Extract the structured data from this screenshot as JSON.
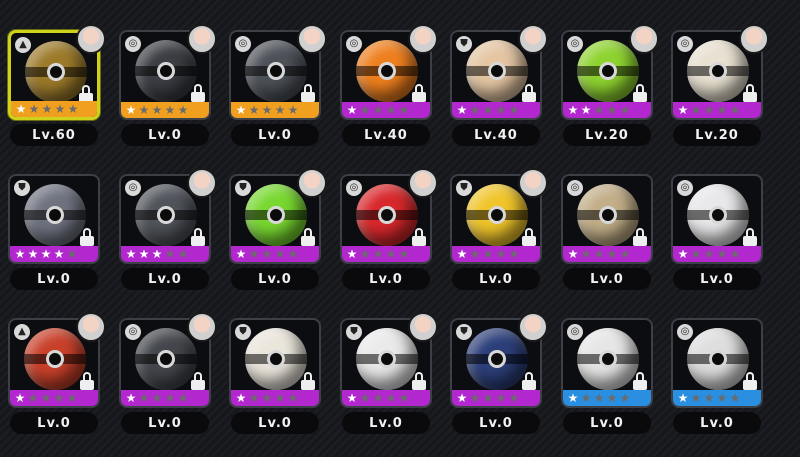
{
  "colors": {
    "frame_selected": "#cfd21a",
    "rarity_orange": "#f0a01e",
    "rarity_purple": "#b327cf",
    "rarity_blue": "#2a8fe0",
    "star_on": "#ffffff",
    "star_off": "#6b6b6b"
  },
  "cards": [
    {
      "id": "card-1",
      "level": "Lv.60",
      "rarity": "orange",
      "stars": 1,
      "selected": true,
      "avatar": true,
      "type_icon": "triangle-type-icon",
      "ball": "gold-cage",
      "ball_color": "#9c7a2a"
    },
    {
      "id": "card-2",
      "level": "Lv.0",
      "rarity": "orange",
      "stars": 1,
      "avatar": true,
      "type_icon": "swirl-type-icon",
      "ball": "shark-mouth",
      "ball_color": "#3b3e44"
    },
    {
      "id": "card-3",
      "level": "Lv.0",
      "rarity": "orange",
      "stars": 1,
      "avatar": true,
      "type_icon": "swirl-type-icon",
      "ball": "armored",
      "ball_color": "#4d5259"
    },
    {
      "id": "card-4",
      "level": "Lv.40",
      "rarity": "purple",
      "stars": 1,
      "avatar": true,
      "type_icon": "swirl-type-icon",
      "ball": "lens",
      "ball_color": "#ee7f1e"
    },
    {
      "id": "card-5",
      "level": "Lv.40",
      "rarity": "purple",
      "stars": 1,
      "avatar": true,
      "type_icon": "shield-type-icon",
      "ball": "plush",
      "ball_color": "#e4c6a3"
    },
    {
      "id": "card-6",
      "level": "Lv.20",
      "rarity": "purple",
      "stars": 2,
      "avatar": true,
      "type_icon": "swirl-type-icon",
      "ball": "helmet",
      "ball_color": "#8fd330"
    },
    {
      "id": "card-7",
      "level": "Lv.20",
      "rarity": "purple",
      "stars": 1,
      "avatar": true,
      "type_icon": "swirl-type-icon",
      "ball": "food",
      "ball_color": "#e8e0d0"
    },
    {
      "id": "card-8",
      "level": "Lv.0",
      "rarity": "purple",
      "stars": 4,
      "avatar": false,
      "type_icon": "shield-type-icon",
      "ball": "visor",
      "ball_color": "#6f7380"
    },
    {
      "id": "card-9",
      "level": "Lv.0",
      "rarity": "purple",
      "stars": 3,
      "avatar": true,
      "type_icon": "swirl-type-icon",
      "ball": "mech",
      "ball_color": "#50545b"
    },
    {
      "id": "card-10",
      "level": "Lv.0",
      "rarity": "purple",
      "stars": 1,
      "avatar": true,
      "type_icon": "shield-type-icon",
      "ball": "monster",
      "ball_color": "#78d830"
    },
    {
      "id": "card-11",
      "level": "Lv.0",
      "rarity": "purple",
      "stars": 1,
      "avatar": true,
      "type_icon": "swirl-type-icon",
      "ball": "ranger",
      "ball_color": "#d8282c"
    },
    {
      "id": "card-12",
      "level": "Lv.0",
      "rarity": "purple",
      "stars": 1,
      "avatar": true,
      "type_icon": "shield-type-icon",
      "ball": "yellow-mech",
      "ball_color": "#f0c52a"
    },
    {
      "id": "card-13",
      "level": "Lv.0",
      "rarity": "purple",
      "stars": 1,
      "avatar": false,
      "type_icon": "swirl-type-icon",
      "ball": "rock",
      "ball_color": "#c2ae88"
    },
    {
      "id": "card-14",
      "level": "Lv.0",
      "rarity": "purple",
      "stars": 1,
      "avatar": false,
      "type_icon": "swirl-type-icon",
      "ball": "robot-face",
      "ball_color": "#e8e8ea"
    },
    {
      "id": "card-15",
      "level": "Lv.0",
      "rarity": "purple",
      "stars": 1,
      "avatar": true,
      "type_icon": "triangle-type-icon",
      "ball": "red-gold",
      "ball_color": "#c8402a"
    },
    {
      "id": "card-16",
      "level": "Lv.0",
      "rarity": "purple",
      "stars": 1,
      "avatar": true,
      "type_icon": "swirl-type-icon",
      "ball": "spiky",
      "ball_color": "#44474d"
    },
    {
      "id": "card-17",
      "level": "Lv.0",
      "rarity": "purple",
      "stars": 1,
      "avatar": false,
      "type_icon": "shield-type-icon",
      "ball": "star-badge",
      "ball_color": "#ebe6dc"
    },
    {
      "id": "card-18",
      "level": "Lv.0",
      "rarity": "purple",
      "stars": 1,
      "avatar": true,
      "type_icon": "shield-type-icon",
      "ball": "tiger",
      "ball_color": "#eaeaea"
    },
    {
      "id": "card-19",
      "level": "Lv.0",
      "rarity": "purple",
      "stars": 1,
      "avatar": true,
      "type_icon": "shield-type-icon",
      "ball": "blue-armor",
      "ball_color": "#2c3f7a"
    },
    {
      "id": "card-20",
      "level": "Lv.0",
      "rarity": "blue",
      "stars": 1,
      "avatar": false,
      "type_icon": "swirl-type-icon",
      "ball": "red-white",
      "ball_color": "#e6e6e6"
    },
    {
      "id": "card-21",
      "level": "Lv.0",
      "rarity": "blue",
      "stars": 1,
      "avatar": false,
      "type_icon": "swirl-type-icon",
      "ball": "white-mech",
      "ball_color": "#dedede"
    }
  ]
}
